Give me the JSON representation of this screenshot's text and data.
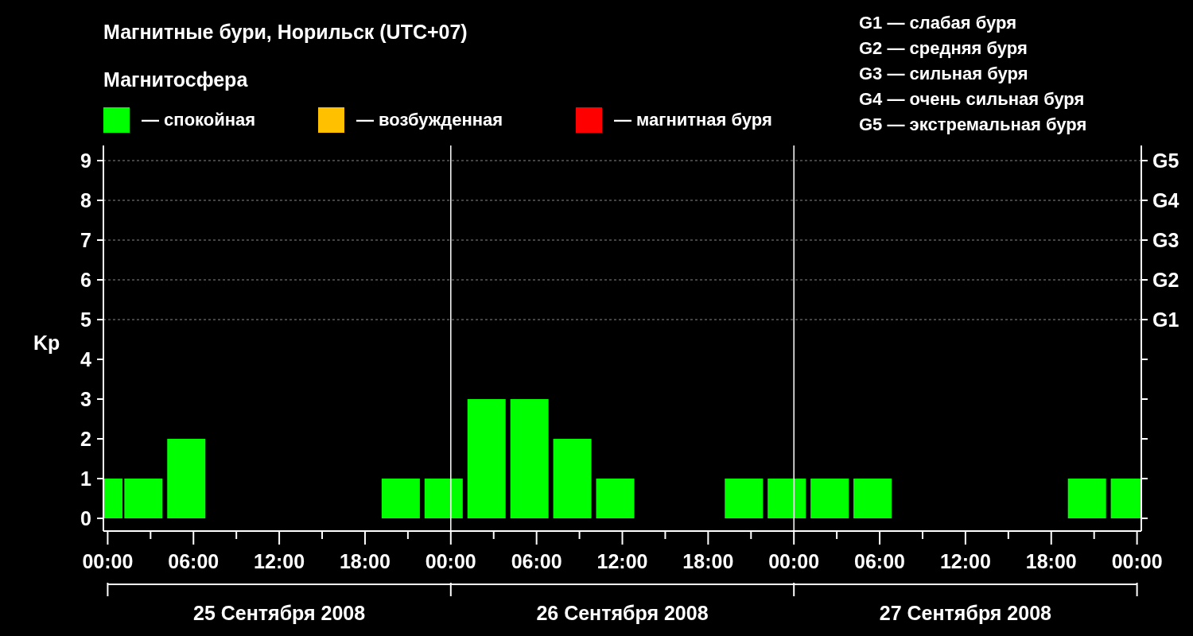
{
  "title": "Магнитные бури, Норильск (UTC+07)",
  "legend": {
    "title": "Магнитосфера",
    "items": [
      {
        "label": "— спокойная",
        "color": "#00ff00"
      },
      {
        "label": "— возбужденная",
        "color": "#ffc000"
      },
      {
        "label": "— магнитная буря",
        "color": "#ff0000"
      }
    ]
  },
  "scale": [
    "G1 — слабая буря",
    "G2 — средняя буря",
    "G3 — сильная буря",
    "G4 — очень сильная буря",
    "G5 — экстремальная буря"
  ],
  "chart": {
    "g_levels": [
      "G5",
      "G4",
      "G3",
      "G2",
      "G1"
    ],
    "time_labels": [
      "00:00",
      "06:00",
      "12:00",
      "18:00",
      "00:00",
      "06:00",
      "12:00",
      "18:00",
      "00:00"
    ],
    "chart_data": {
      "type": "bar",
      "ylabel": "Kp",
      "grid": true,
      "x": [
        -0.3,
        2.5,
        5.5,
        8.5,
        11.5,
        14.5,
        17.5,
        20.5,
        23.5,
        26.5,
        29.5,
        32.5,
        35.5,
        38.5,
        41.5,
        44.5,
        47.5,
        50.5,
        53.5,
        56.5,
        59.5,
        62.5,
        65.5,
        68.5,
        71.5
      ],
      "xlim": [
        -0.3,
        72.3
      ],
      "ref_lines": [
        {
          "axis": "x",
          "value": 24
        },
        {
          "axis": "x",
          "value": 48
        }
      ],
      "xticks": [
        {
          "value": 0,
          "label": "00:00"
        },
        {
          "value": 6,
          "label": "06:00"
        },
        {
          "value": 12,
          "label": "12:00"
        },
        {
          "value": 18,
          "label": "18:00"
        }
      ],
      "series": [
        {
          "color": "#00ff00",
          "values": [
            1,
            1,
            2,
            0,
            0,
            0,
            0,
            1,
            1,
            3,
            3,
            2,
            1,
            0,
            0,
            1,
            1,
            1,
            1,
            0,
            0,
            0,
            0,
            1,
            1
          ]
        }
      ],
      "ylim": [
        -0.32,
        9.38
      ],
      "yticks": [
        0,
        1,
        2,
        3,
        4,
        5,
        6,
        7,
        8,
        9
      ]
    }
  },
  "days": [
    "25 Сентября 2008",
    "26 Сентября 2008",
    "27 Сентября 2008"
  ]
}
